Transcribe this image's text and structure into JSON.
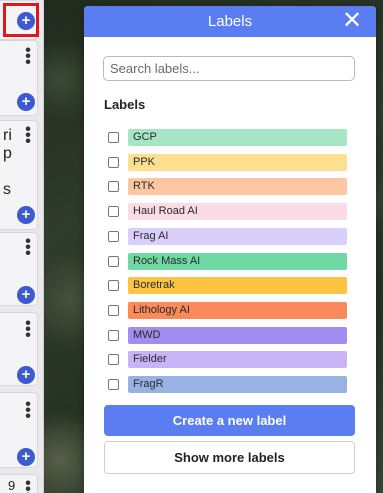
{
  "panel": {
    "title": "Labels",
    "close_icon": "close-icon",
    "search_placeholder": "Search labels...",
    "section_heading": "Labels",
    "labels": [
      {
        "name": "GCP",
        "color": "#a6e6c4"
      },
      {
        "name": "PPK",
        "color": "#fde08f"
      },
      {
        "name": "RTK",
        "color": "#fdc7a4"
      },
      {
        "name": "Haul Road AI",
        "color": "#fbdbe6"
      },
      {
        "name": "Frag AI",
        "color": "#dacffb"
      },
      {
        "name": "Rock Mass AI",
        "color": "#6fd8a3"
      },
      {
        "name": "Boretrak",
        "color": "#fdc443"
      },
      {
        "name": "Lithology AI",
        "color": "#fa8a5a"
      },
      {
        "name": "MWD",
        "color": "#a28cf0"
      },
      {
        "name": "Fielder",
        "color": "#c9b3f7"
      },
      {
        "name": "FragR",
        "color": "#98b3e3"
      }
    ],
    "create_button": "Create a new label",
    "show_more_button": "Show more labels"
  },
  "left_list": {
    "add_icon": "plus-icon",
    "menu_icon": "kebab-menu-icon",
    "partial_text_1": "ri",
    "partial_text_2": "p",
    "partial_text_3": "s",
    "partial_text_4": "9"
  },
  "colors": {
    "accent": "#5b7df2",
    "add_button": "#3d5bd0",
    "highlight": "#e0181e"
  }
}
